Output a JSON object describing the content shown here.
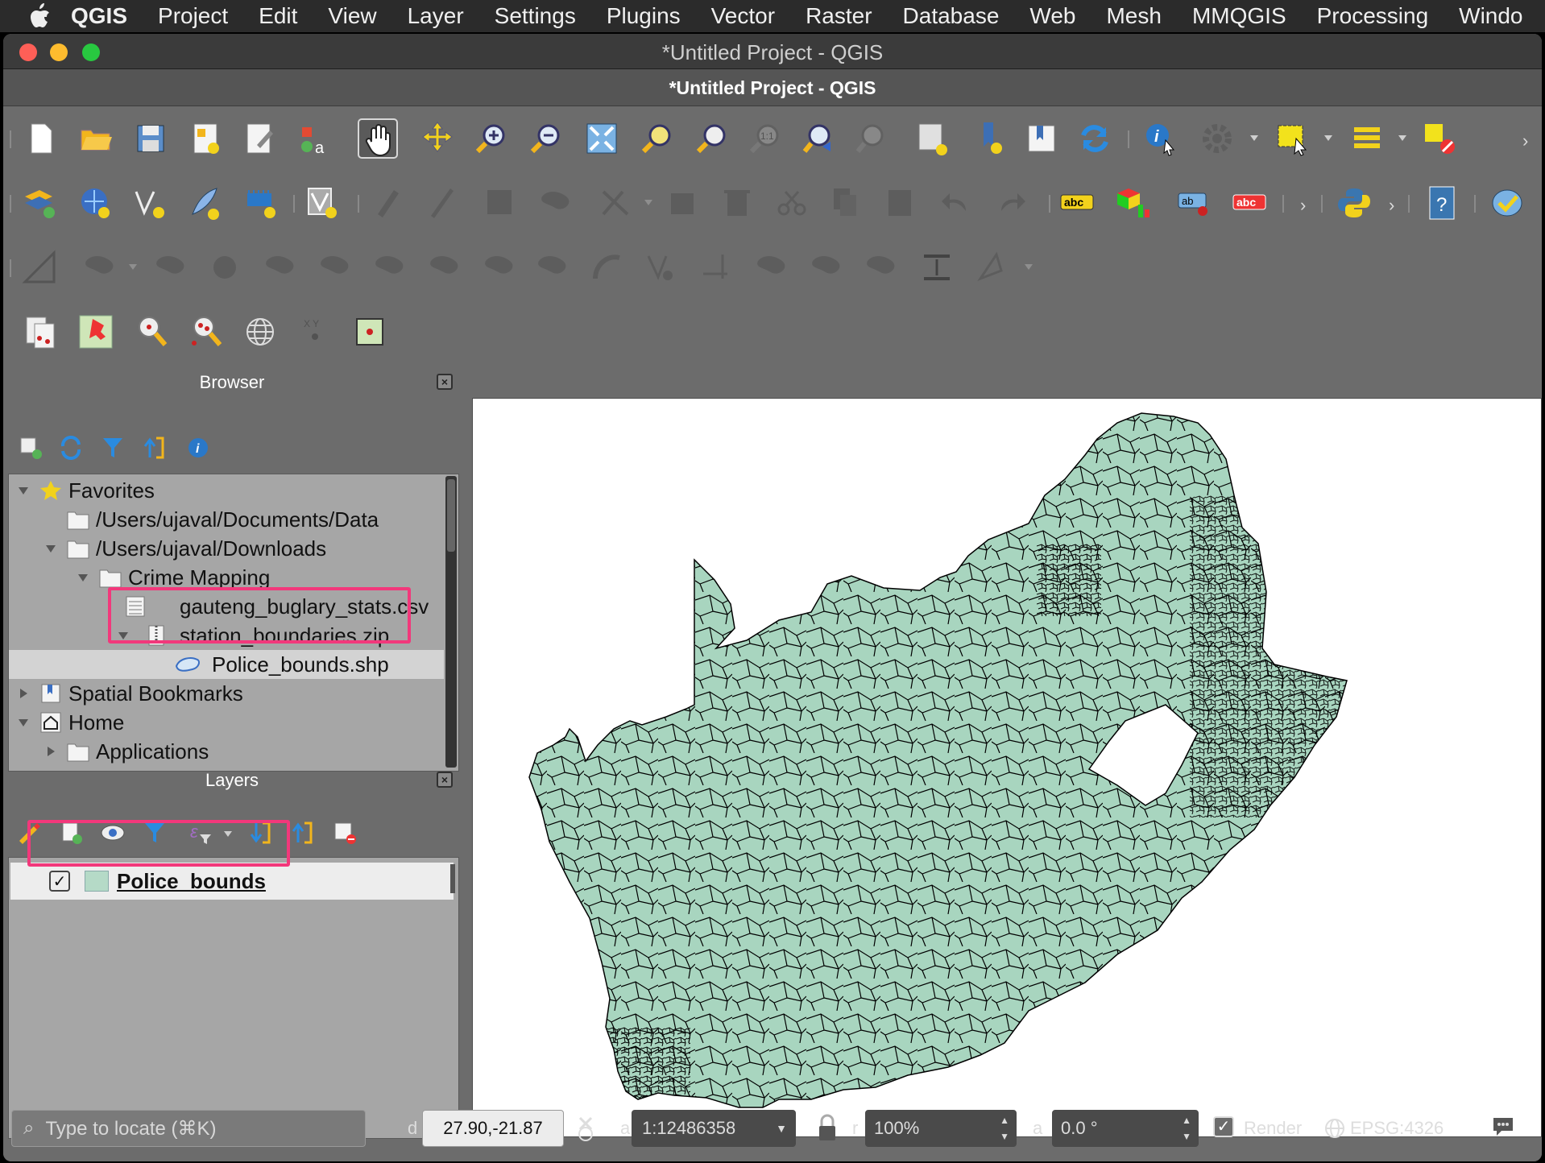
{
  "menubar": {
    "items": [
      "QGIS",
      "Project",
      "Edit",
      "View",
      "Layer",
      "Settings",
      "Plugins",
      "Vector",
      "Raster",
      "Database",
      "Web",
      "Mesh",
      "MMQGIS",
      "Processing",
      "Windo"
    ]
  },
  "window": {
    "title": "*Untitled Project - QGIS",
    "document_title": "*Untitled Project - QGIS"
  },
  "browser": {
    "title": "Browser",
    "items": [
      {
        "label": "Favorites"
      },
      {
        "label": "/Users/ujaval/Documents/Data"
      },
      {
        "label": "/Users/ujaval/Downloads"
      },
      {
        "label": "Crime Mapping"
      },
      {
        "label": "gauteng_buglary_stats.csv"
      },
      {
        "label": "station_boundaries.zip"
      },
      {
        "label": "Police_bounds.shp"
      },
      {
        "label": "Spatial Bookmarks"
      },
      {
        "label": "Home"
      },
      {
        "label": "Applications"
      }
    ]
  },
  "layers": {
    "title": "Layers",
    "items": [
      {
        "name": "Police_bounds",
        "checked": true,
        "fill_color": "#b5dac7"
      }
    ]
  },
  "map": {
    "fill_color": "#a8d5bf",
    "stroke_color": "#000000"
  },
  "statusbar": {
    "locator_placeholder": "Type to locate (⌘K)",
    "coordinate": "27.90,-21.87",
    "scale": "1:12486358",
    "magnifier": "100%",
    "rotation": "0.0 °",
    "render_label": "Render",
    "render_checked": true,
    "crs": "EPSG:4326"
  },
  "highlight_color": "#f2387b"
}
